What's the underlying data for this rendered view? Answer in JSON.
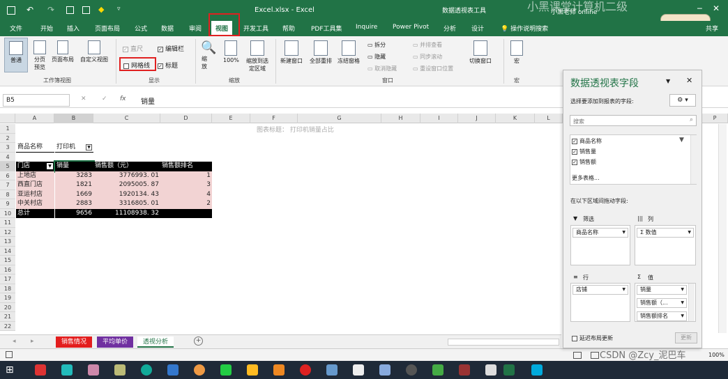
{
  "titlebar": {
    "filename": "Excel.xlsx  -  Excel",
    "context_tool": "数据透视表工具",
    "user": "小黑老师 online",
    "watermark": "小黑课堂计算机二级"
  },
  "tabs": [
    "文件",
    "开始",
    "插入",
    "页面布局",
    "公式",
    "数据",
    "审阅",
    "视图",
    "开发工具",
    "帮助",
    "PDF工具集",
    "Inquire",
    "Power Pivot",
    "分析",
    "设计",
    "操作说明搜索",
    "共享"
  ],
  "ribbon": {
    "views": [
      "普通",
      "分页预览",
      "页面布局",
      "自定义视图"
    ],
    "views_group": "工作簿视图",
    "show": {
      "ruler": "直尺",
      "formula_bar": "编辑栏",
      "gridlines": "网格线",
      "headings": "标题"
    },
    "show_group": "显示",
    "zoom": [
      "缩放",
      "100%",
      "缩放到选定区域"
    ],
    "zoom_group": "缩放",
    "window": [
      "新建窗口",
      "全部重排",
      "冻结窗格"
    ],
    "window_small": [
      "拆分",
      "隐藏",
      "取消隐藏",
      "并排查看",
      "同步滚动",
      "重设窗口位置"
    ],
    "switch": "切换窗口",
    "window_group": "窗口",
    "macro": "宏",
    "macro_group": "宏"
  },
  "formula_bar": {
    "name_box": "B5",
    "fx": "fx",
    "value": "销量"
  },
  "columns": [
    "A",
    "B",
    "C",
    "D",
    "E",
    "F",
    "G",
    "H",
    "I",
    "J",
    "K",
    "L",
    "M",
    "N",
    "O",
    "P"
  ],
  "rows": [
    "1",
    "2",
    "3",
    "4",
    "5",
    "6",
    "7",
    "8",
    "9",
    "10",
    "11",
    "12",
    "13",
    "14",
    "15",
    "16",
    "17",
    "18",
    "19",
    "20",
    "21",
    "22"
  ],
  "sheet": {
    "chart_title_placeholder": "图表标题： 打印机销量占比",
    "filter_label": "商品名称",
    "filter_value": "打印机",
    "headers": [
      "门店",
      "销量",
      "销售额（元）",
      "销售额排名"
    ],
    "data": [
      [
        "上地店",
        "3283",
        "3776993. 01",
        "1"
      ],
      [
        "西直门店",
        "1821",
        "2095005. 87",
        "3"
      ],
      [
        "亚运村店",
        "1669",
        "1920134. 43",
        "4"
      ],
      [
        "中关村店",
        "2883",
        "3316805. 01",
        "2"
      ]
    ],
    "total": [
      "总计",
      "9656",
      "11108938. 32",
      ""
    ]
  },
  "sheet_tabs": [
    "销售情况",
    "平均单价",
    "透视分析"
  ],
  "status": {
    "zoom": "100%",
    "watermark": "CSDN @Zcy_泥巴车"
  },
  "pivot_pane": {
    "title": "数据透视表字段",
    "subtitle": "选择要添加到报表的字段:",
    "search": "搜索",
    "fields": [
      "商品名称",
      "销售量",
      "销售额"
    ],
    "more_tables": "更多表格...",
    "drag_hint": "在以下区域间拖动字段:",
    "filters_label": "筛选",
    "columns_label": "列",
    "rows_label": "行",
    "values_label": "值",
    "filters_items": [
      "商品名称"
    ],
    "columns_items": [
      "Σ 数值"
    ],
    "rows_items": [
      "店铺"
    ],
    "values_items": [
      "销量",
      "销售额（...",
      "销售额排名"
    ],
    "defer": "延迟布局更新",
    "update": "更新"
  },
  "colors": {
    "excel_green": "#217346",
    "highlight_red": "#e02020"
  }
}
